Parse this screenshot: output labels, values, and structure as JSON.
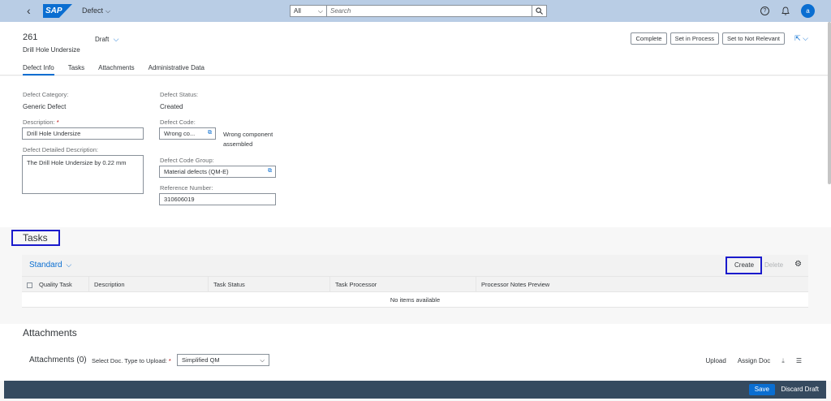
{
  "shell": {
    "back": "‹",
    "logo": "SAP",
    "app_title": "Defect",
    "search_scope": "All",
    "search_placeholder": "Search",
    "avatar_initial": "a"
  },
  "header": {
    "id": "261",
    "subtitle": "Drill Hole Undersize",
    "status": "Draft",
    "actions": [
      "Complete",
      "Set in Process",
      "Set to Not Relevant"
    ],
    "tabs": [
      "Defect Info",
      "Tasks",
      "Attachments",
      "Administrative Data"
    ]
  },
  "defect_info": {
    "category_label": "Defect Category:",
    "category_value": "Generic Defect",
    "description_label": "Description:",
    "description_value": "Drill Hole Undersize",
    "detailed_label": "Defect Detailed Description:",
    "detailed_value": "The Drill Hole Undersize by 0.22 mm",
    "status_label": "Defect Status:",
    "status_value": "Created",
    "code_label": "Defect Code:",
    "code_value": "Wrong co...",
    "code_desc": "Wrong component assembled",
    "code_group_label": "Defect Code Group:",
    "code_group_value": "Material defects (QM-E)",
    "ref_label": "Reference Number:",
    "ref_value": "310606019"
  },
  "tasks": {
    "title": "Tasks",
    "variant": "Standard",
    "create": "Create",
    "delete": "Delete",
    "columns": [
      "Quality Task",
      "Description",
      "Task Status",
      "Task Processor",
      "Processor Notes Preview"
    ],
    "empty": "No items available"
  },
  "attachments": {
    "title": "Attachments",
    "toolbar_title": "Attachments (0)",
    "doc_type_label": "Select Doc. Type to Upload:",
    "doc_type_value": "Simplified QM",
    "upload": "Upload",
    "assign": "Assign Doc"
  },
  "footer": {
    "save": "Save",
    "discard": "Discard Draft"
  },
  "colors": {
    "shell": "#b9cde5",
    "accent": "#0a6ed1",
    "footer": "#354a5f",
    "highlight": "#1a1acc"
  }
}
